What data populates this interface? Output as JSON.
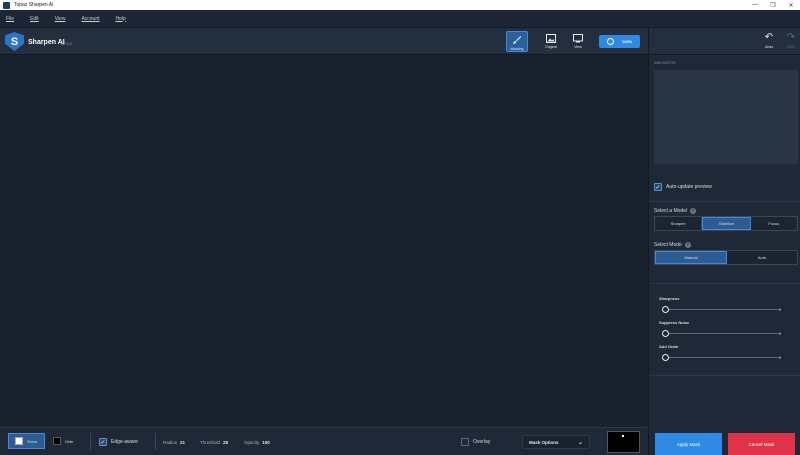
{
  "window": {
    "title": "Topaz Sharpen AI",
    "controls": [
      "—",
      "❐",
      "✕"
    ]
  },
  "menu": [
    "File",
    "Edit",
    "View",
    "Account",
    "Help"
  ],
  "header": {
    "app_name": "Sharpen AI",
    "version": "v2.0.2",
    "tools": [
      {
        "label": "Masking",
        "icon": "brush-icon",
        "active": true
      },
      {
        "label": "Original",
        "icon": "image-icon",
        "active": false
      },
      {
        "label": "View",
        "icon": "monitor-icon",
        "active": false
      }
    ],
    "zoom_label": "100%"
  },
  "right_panel": {
    "undo_label": "Undo",
    "redo_label": "Redo",
    "navigator_title": "NAVIGATOR",
    "auto_update_label": "Auto-update preview",
    "auto_update_checked": true,
    "model_label": "Select a Model",
    "models": [
      "Sharpen",
      "Stabilize",
      "Focus"
    ],
    "selected_model": "Stabilize",
    "mode_label": "Select Mode",
    "modes": [
      "Manual",
      "Auto"
    ],
    "selected_mode": "Manual",
    "sliders": [
      {
        "label": "Sharpness",
        "value": "0"
      },
      {
        "label": "Suppress Noise",
        "value": "0"
      },
      {
        "label": "Add Grain",
        "value": "0"
      }
    ],
    "apply_label": "Apply Mask",
    "cancel_label": "Cancel Mask"
  },
  "bottom_bar": {
    "show_label": "Show",
    "hide_label": "Hide",
    "edge_aware_label": "Edge-aware",
    "edge_aware_checked": true,
    "radius_label": "Radius",
    "radius_value": "21",
    "threshold_label": "Threshold",
    "threshold_value": "28",
    "opacity_label": "Opacity",
    "opacity_value": "100",
    "overlay_label": "Overlay",
    "overlay_checked": false,
    "mask_options_label": "Mask Options"
  },
  "colors": {
    "accent": "#2f8ae5",
    "cancel": "#e0334a",
    "selected": "#2d5c94",
    "canvas": "#19222f"
  }
}
